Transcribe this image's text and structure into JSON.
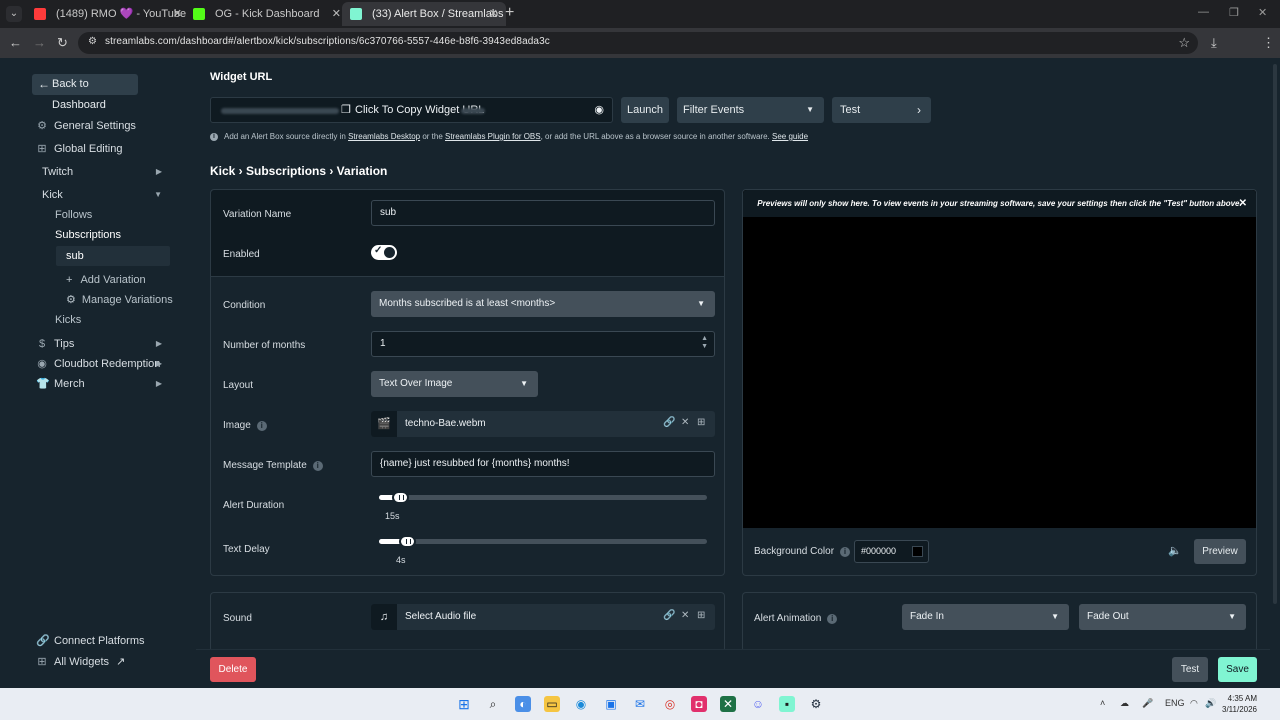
{
  "browser": {
    "tabs": [
      {
        "title": "(1489) RMO 💜 - YouTube",
        "color": "#ff3b3b"
      },
      {
        "title": "OG - Kick Dashboard",
        "color": "#53fc18"
      },
      {
        "title": "(33) Alert Box / Streamlabs",
        "color": "#80f5d2"
      }
    ],
    "url": "streamlabs.com/dashboard#/alertbox/kick/subscriptions/6c370766-5557-446e-b8f6-3943ed8ada3c"
  },
  "sidebar": {
    "back": "Back to Dashboard",
    "general_settings": "General Settings",
    "global_editing": "Global Editing",
    "twitch": "Twitch",
    "kick": "Kick",
    "follows": "Follows",
    "subscriptions": "Subscriptions",
    "sub": "sub",
    "add_variation": "Add Variation",
    "manage_variations": "Manage Variations",
    "kicks": "Kicks",
    "tips": "Tips",
    "cloudbot": "Cloudbot Redemption",
    "merch": "Merch",
    "connect_platforms": "Connect Platforms",
    "all_widgets": "All Widgets"
  },
  "header": {
    "widget_url_label": "Widget URL",
    "copy": "Click To Copy Widget URL",
    "launch": "Launch",
    "filter_events": "Filter Events",
    "test": "Test",
    "hint_1": "Add an Alert Box source directly in ",
    "hint_link_1": "Streamlabs Desktop",
    "hint_2": " or the ",
    "hint_link_2": "Streamlabs Plugin for OBS",
    "hint_3": ", or add the URL above as a browser source in another software. ",
    "hint_link_3": "See guide",
    "breadcrumb": "Kick › Subscriptions › Variation"
  },
  "form": {
    "variation_name_label": "Variation Name",
    "variation_name_value": "sub",
    "enabled_label": "Enabled",
    "enabled": true,
    "condition_label": "Condition",
    "condition_value": "Months subscribed is at least <months>",
    "months_label": "Number of months",
    "months_value": "1",
    "layout_label": "Layout",
    "layout_value": "Text Over Image",
    "image_label": "Image",
    "image_value": "techno-Bae.webm",
    "message_label": "Message Template",
    "message_value": "{name} just resubbed for {months} months!",
    "duration_label": "Alert Duration",
    "duration_value": "15s",
    "duration_fraction": 0.04,
    "text_delay_label": "Text Delay",
    "text_delay_value": "4s",
    "text_delay_fraction": 0.06,
    "sound_label": "Sound",
    "sound_value": "Select Audio file"
  },
  "preview": {
    "message": "Previews will only show here. To view events in your streaming software, save your settings then click the \"Test\" button above.",
    "bg_label": "Background Color",
    "bg_value": "#000000",
    "preview_btn": "Preview"
  },
  "animation": {
    "label": "Alert Animation",
    "in": "Fade In",
    "out": "Fade Out"
  },
  "footer": {
    "delete": "Delete",
    "test": "Test",
    "save": "Save"
  },
  "taskbar": {
    "lang": "ENG",
    "time": "4:35 AM",
    "date": "3/11/2026"
  }
}
